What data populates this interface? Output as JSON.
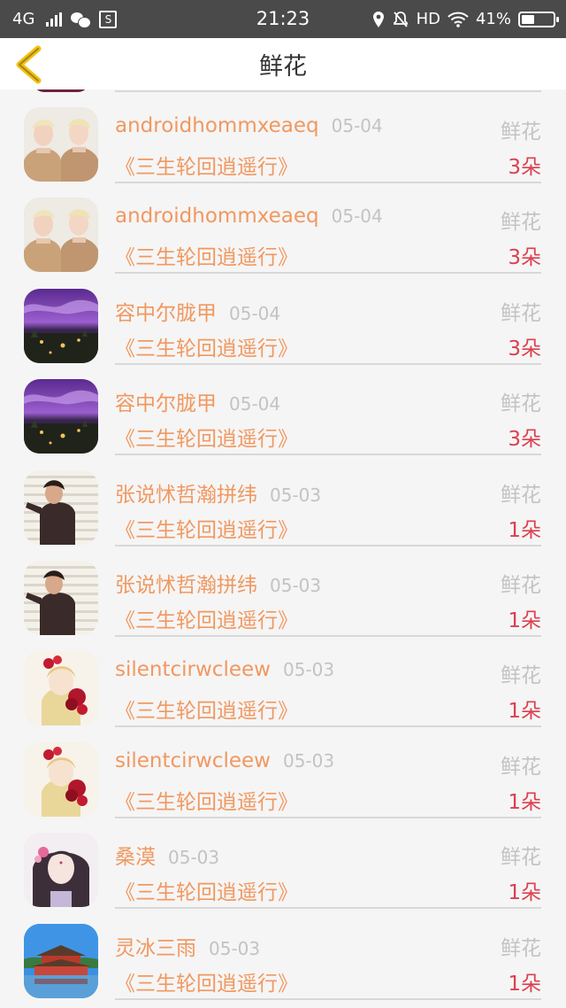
{
  "status_bar": {
    "network": "4G",
    "time": "21:23",
    "hd": "HD",
    "battery": "41%",
    "battery_level": 0.41
  },
  "header": {
    "title": "鲜花"
  },
  "list": [
    {
      "name": "androidhommxeaeq",
      "date": "05-04",
      "category": "鲜花",
      "gift": "《三生轮回逍遥行》",
      "count": "3朵",
      "avatar": "twins"
    },
    {
      "name": "androidhommxeaeq",
      "date": "05-04",
      "category": "鲜花",
      "gift": "《三生轮回逍遥行》",
      "count": "3朵",
      "avatar": "twins"
    },
    {
      "name": "容中尔胧甲",
      "date": "05-04",
      "category": "鲜花",
      "gift": "《三生轮回逍遥行》",
      "count": "3朵",
      "avatar": "purple-night"
    },
    {
      "name": "容中尔胧甲",
      "date": "05-04",
      "category": "鲜花",
      "gift": "《三生轮回逍遥行》",
      "count": "3朵",
      "avatar": "purple-night"
    },
    {
      "name": "张说怵哲瀚拼纬",
      "date": "05-03",
      "category": "鲜花",
      "gift": "《三生轮回逍遥行》",
      "count": "1朵",
      "avatar": "man-blinds"
    },
    {
      "name": "张说怵哲瀚拼纬",
      "date": "05-03",
      "category": "鲜花",
      "gift": "《三生轮回逍遥行》",
      "count": "1朵",
      "avatar": "man-blinds"
    },
    {
      "name": "silentcirwcleew",
      "date": "05-03",
      "category": "鲜花",
      "gift": "《三生轮回逍遥行》",
      "count": "1朵",
      "avatar": "anime-roses"
    },
    {
      "name": "silentcirwcleew",
      "date": "05-03",
      "category": "鲜花",
      "gift": "《三生轮回逍遥行》",
      "count": "1朵",
      "avatar": "anime-roses"
    },
    {
      "name": "桑漠",
      "date": "05-03",
      "category": "鲜花",
      "gift": "《三生轮回逍遥行》",
      "count": "1朵",
      "avatar": "anime-girl"
    },
    {
      "name": "灵冰三雨",
      "date": "05-03",
      "category": "鲜花",
      "gift": "《三生轮回逍遥行》",
      "count": "1朵",
      "avatar": "temple"
    }
  ]
}
